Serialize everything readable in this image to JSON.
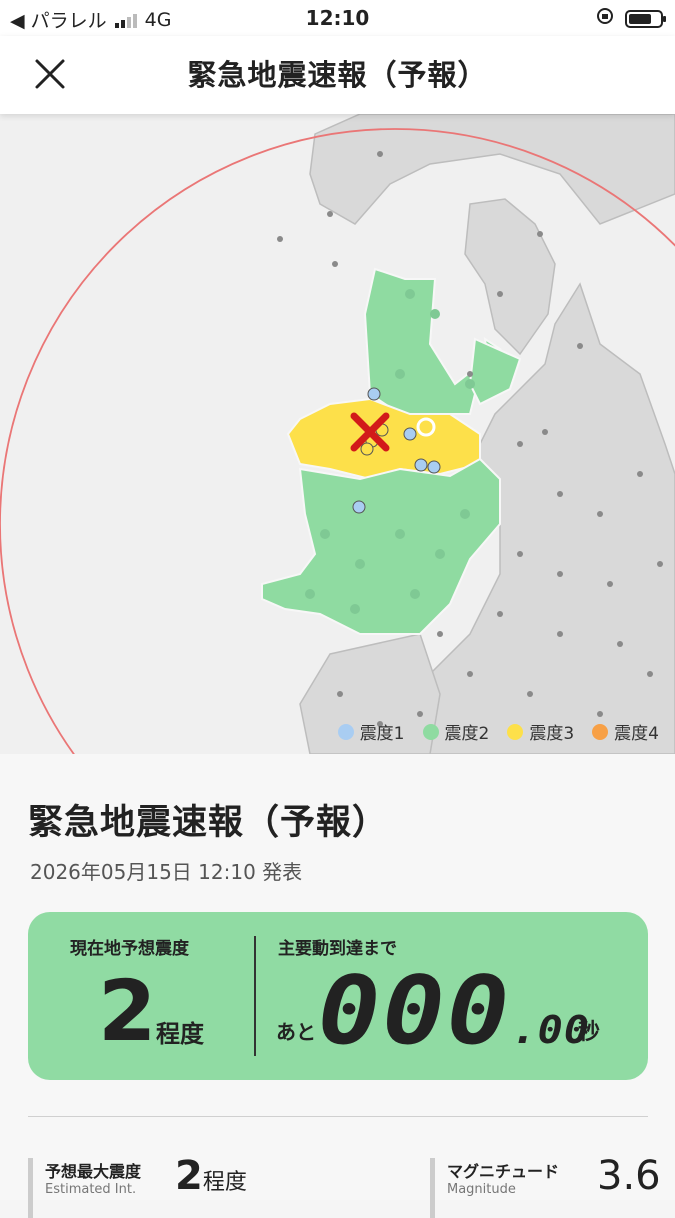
{
  "status_bar": {
    "back_app": "◀ パラレル",
    "network": "4G",
    "time": "12:10"
  },
  "header": {
    "title": "緊急地震速報（予報）",
    "close_icon": "close-icon"
  },
  "legend": [
    {
      "label": "震度1",
      "color": "#a9cdf2"
    },
    {
      "label": "震度2",
      "color": "#8fdba1"
    },
    {
      "label": "震度3",
      "color": "#fde04a"
    },
    {
      "label": "震度4",
      "color": "#f7a046"
    }
  ],
  "detail": {
    "title": "緊急地震速報（予報）",
    "issued": "2026年05月15日 12:10 発表",
    "card": {
      "current_label": "現在地予想震度",
      "current_value": "2",
      "current_unit": "程度",
      "arrival_label": "主要動到達まで",
      "arrival_prefix": "あと",
      "arrival_main": "000",
      "arrival_frac": ".00",
      "arrival_unit": "秒",
      "color": "#90dba3"
    },
    "max_intensity": {
      "label": "予想最大震度",
      "sub": "Estimated Int.",
      "value": "2",
      "unit": "程度"
    },
    "magnitude": {
      "label": "マグニチュード",
      "sub": "Magnitude",
      "value": "3.6"
    }
  }
}
